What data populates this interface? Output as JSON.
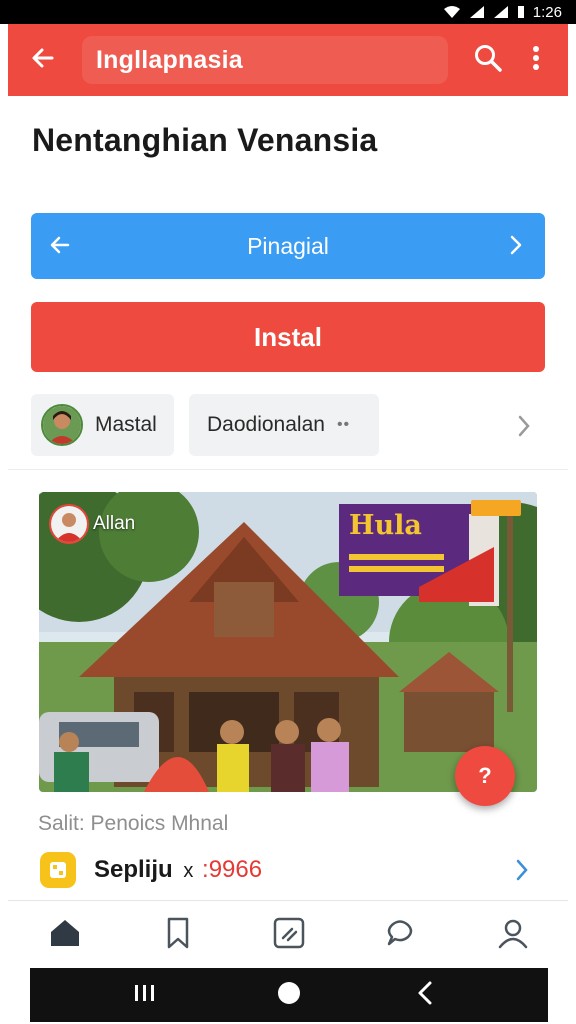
{
  "status_bar": {
    "time": "1:26"
  },
  "app_bar": {
    "title": "Ingllapnasia",
    "back_icon": "arrow-left-icon",
    "search_icon": "search-icon",
    "more_icon": "more-vertical-icon",
    "color": "#ee4a3f"
  },
  "page": {
    "title": "Nentanghian Venansia"
  },
  "nav_button": {
    "label": "Pinagial",
    "color": "#3a9cf3"
  },
  "install_button": {
    "label": "Instal",
    "color": "#ee4a3f"
  },
  "chips": [
    {
      "label": "Mastal",
      "icon": "avatar"
    },
    {
      "label": "Daodionalan",
      "extra": "••"
    }
  ],
  "media": {
    "author": "Allan",
    "banner_title": "Hula"
  },
  "fab": {
    "label": "?"
  },
  "caption": "Salit: Penoics Mhnal",
  "list_row": {
    "label": "Sepliju",
    "separator": "x",
    "value": ":9966",
    "icon": "app-icon"
  },
  "bottom_nav": {
    "tabs": [
      {
        "name": "home",
        "icon": "home-icon",
        "active": true
      },
      {
        "name": "bookmark",
        "icon": "bookmark-icon",
        "active": false
      },
      {
        "name": "edit",
        "icon": "edit-icon",
        "active": false
      },
      {
        "name": "chat",
        "icon": "chat-icon",
        "active": false
      },
      {
        "name": "profile",
        "icon": "person-icon",
        "active": false
      }
    ]
  },
  "system_nav": {
    "recents_icon": "recents-icon",
    "home_icon": "home-circle-icon",
    "back_icon": "back-chevron-icon"
  }
}
